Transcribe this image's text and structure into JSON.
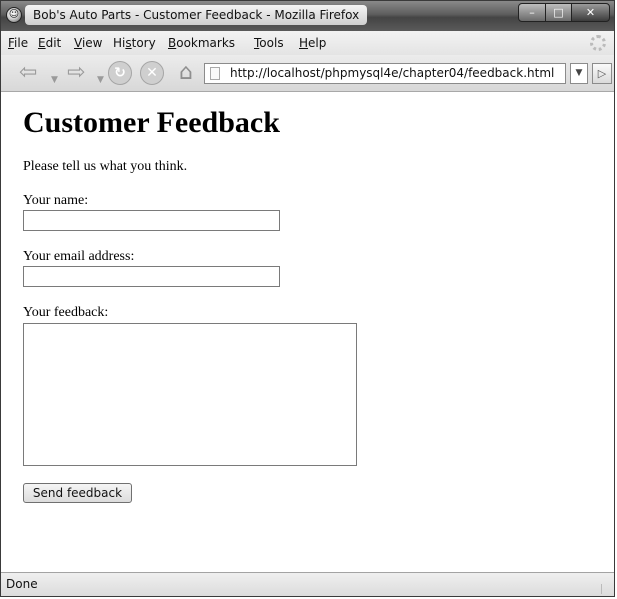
{
  "window": {
    "title": "Bob's Auto Parts - Customer Feedback - Mozilla Firefox"
  },
  "menu": {
    "file": "ile",
    "file_key": "F",
    "edit": "dit",
    "edit_key": "E",
    "view": "iew",
    "view_key": "V",
    "history_pre": "Hi",
    "history_key": "s",
    "history_post": "tory",
    "bookmarks": "ookmarks",
    "bookmarks_key": "B",
    "tools": "ools",
    "tools_key": "T",
    "help": "elp",
    "help_key": "H"
  },
  "toolbar": {
    "url": "http://localhost/phpmysql4e/chapter04/feedback.html",
    "icons": [
      "back-icon",
      "forward-icon",
      "reload-icon",
      "stop-icon",
      "home-icon",
      "go-icon"
    ]
  },
  "page": {
    "heading": "Customer Feedback",
    "intro": "Please tell us what you think.",
    "name_label": "Your name:",
    "email_label": "Your email address:",
    "feedback_label": "Your feedback:",
    "name_value": "",
    "email_value": "",
    "feedback_value": "",
    "submit_label": "Send feedback"
  },
  "status": {
    "text": "Done"
  }
}
